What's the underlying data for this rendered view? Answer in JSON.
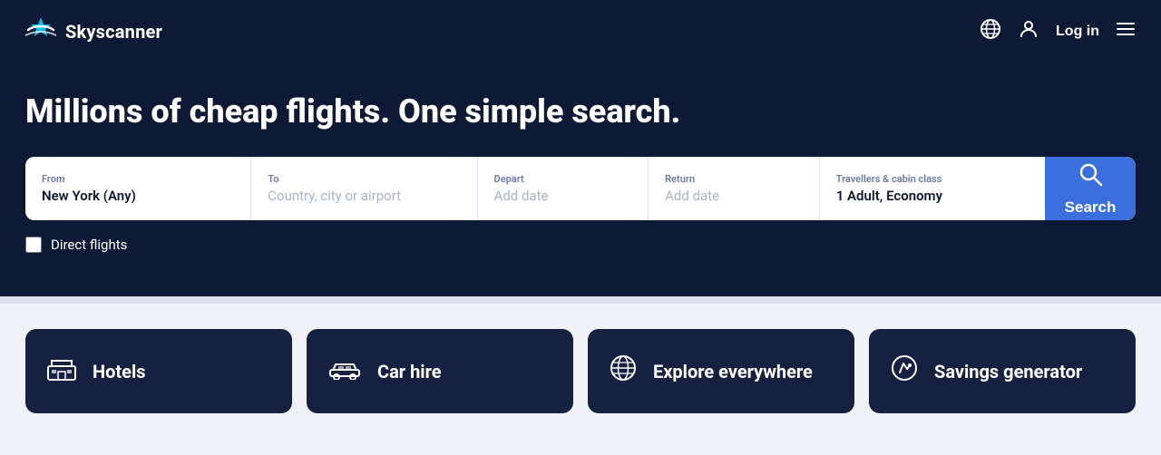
{
  "brand": {
    "name": "Skyscanner",
    "logo_icon": "✦"
  },
  "navbar": {
    "globe_icon": "🌐",
    "user_icon": "👤",
    "login_label": "Log in",
    "menu_icon": "☰"
  },
  "hero": {
    "title": "Millions of cheap flights. One simple search."
  },
  "search": {
    "from_label": "From",
    "from_value": "New York (Any)",
    "to_label": "To",
    "to_placeholder": "Country, city or airport",
    "depart_label": "Depart",
    "depart_placeholder": "Add date",
    "return_label": "Return",
    "return_placeholder": "Add date",
    "cabin_label": "Travellers & cabin class",
    "cabin_value": "1 Adult, Economy",
    "search_button_label": "Search"
  },
  "direct_flights": {
    "label": "Direct flights"
  },
  "cards": [
    {
      "id": "hotels",
      "icon": "🛏",
      "label": "Hotels"
    },
    {
      "id": "car-hire",
      "icon": "🚗",
      "label": "Car hire"
    },
    {
      "id": "explore",
      "icon": "🌐",
      "label": "Explore everywhere"
    },
    {
      "id": "savings",
      "icon": "🏷",
      "label": "Savings generator"
    }
  ]
}
